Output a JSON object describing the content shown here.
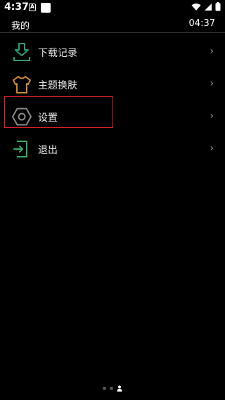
{
  "status_bar": {
    "time": "4:37",
    "a_icon_text": "A"
  },
  "header": {
    "title": "我的",
    "time": "04:37"
  },
  "menu": {
    "items": [
      {
        "label": "下载记录",
        "icon": "download-icon",
        "chevron": "›"
      },
      {
        "label": "主题换肤",
        "icon": "tshirt-icon",
        "chevron": "›"
      },
      {
        "label": "设置",
        "icon": "hexagon-settings-icon",
        "chevron": "›"
      },
      {
        "label": "退出",
        "icon": "exit-icon",
        "chevron": "›"
      }
    ]
  },
  "colors": {
    "background": "#000000",
    "download_icon": "#2e9a78",
    "theme_icon": "#c8873a",
    "settings_icon": "#8a8a8a",
    "exit_icon": "#3aaa6a",
    "highlight": "#e02020"
  },
  "page_indicator": {
    "count": 3,
    "active_index": 2,
    "active_icon": "person-icon"
  }
}
